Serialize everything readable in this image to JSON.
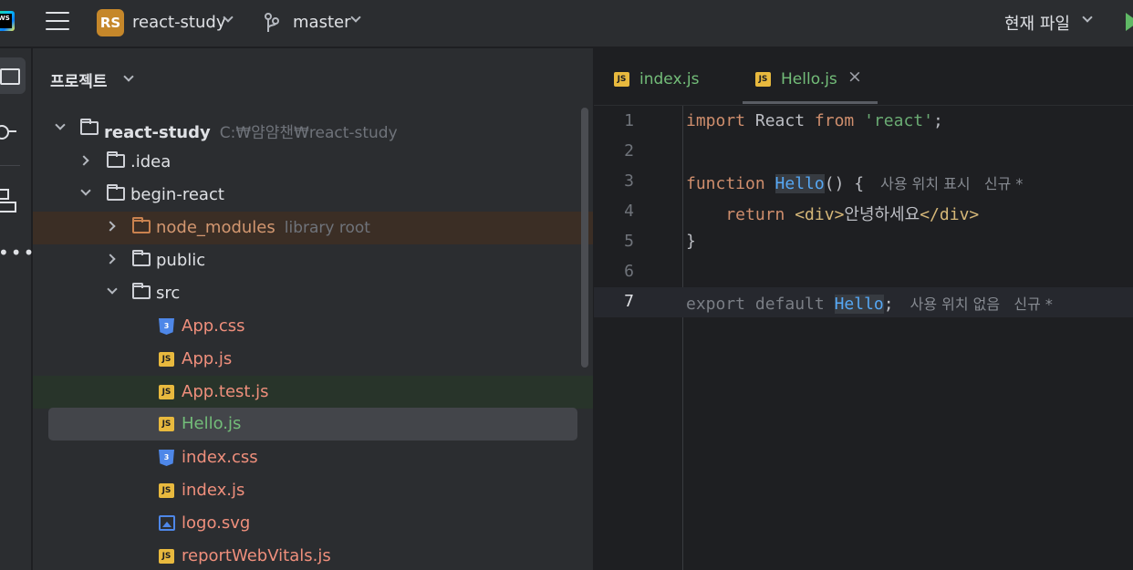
{
  "titlebar": {
    "logo_text": "WS",
    "project_badge": "RS",
    "project_name": "react-study",
    "branch": "master",
    "current_file_label": "현재 파일"
  },
  "panel": {
    "title": "프로젝트",
    "rows": [
      {
        "label": "react-study",
        "hint": "C:₩얌얌챈₩react-study"
      },
      {
        "label": ".idea"
      },
      {
        "label": "begin-react"
      },
      {
        "label": "node_modules",
        "hint": "library root"
      },
      {
        "label": "public"
      },
      {
        "label": "src"
      },
      {
        "label": "App.css",
        "icon": "css-icon"
      },
      {
        "label": "App.js",
        "icon": "js-icon"
      },
      {
        "label": "App.test.js",
        "icon": "js-test-icon"
      },
      {
        "label": "Hello.js",
        "icon": "js-icon"
      },
      {
        "label": "index.css",
        "icon": "css-icon"
      },
      {
        "label": "index.js",
        "icon": "js-icon"
      },
      {
        "label": "logo.svg",
        "icon": "image-icon"
      },
      {
        "label": "reportWebVitals.js",
        "icon": "js-icon"
      }
    ]
  },
  "editor": {
    "tabs": [
      {
        "label": "index.js"
      },
      {
        "label": "Hello.js",
        "active": true
      }
    ],
    "line_numbers": [
      "1",
      "2",
      "3",
      "4",
      "5",
      "6",
      "7"
    ],
    "current_line": 7,
    "code": {
      "l1_import": "import",
      "l1_react": " React ",
      "l1_from": "from",
      "l1_str": "'react'",
      "l1_semi": ";",
      "l3_function": "function",
      "l3_name": "Hello",
      "l3_rest": "() {",
      "l3_inlay": "사용 위치 표시   신규 *",
      "l4_return": "    return ",
      "l4_open": "<div>",
      "l4_text": "안녕하세요",
      "l4_close": "</div>",
      "l5": "}",
      "l7_export": "export default ",
      "l7_name": "Hello",
      "l7_semi": ";",
      "l7_inlay": "사용 위치 없음   신규 *"
    }
  }
}
